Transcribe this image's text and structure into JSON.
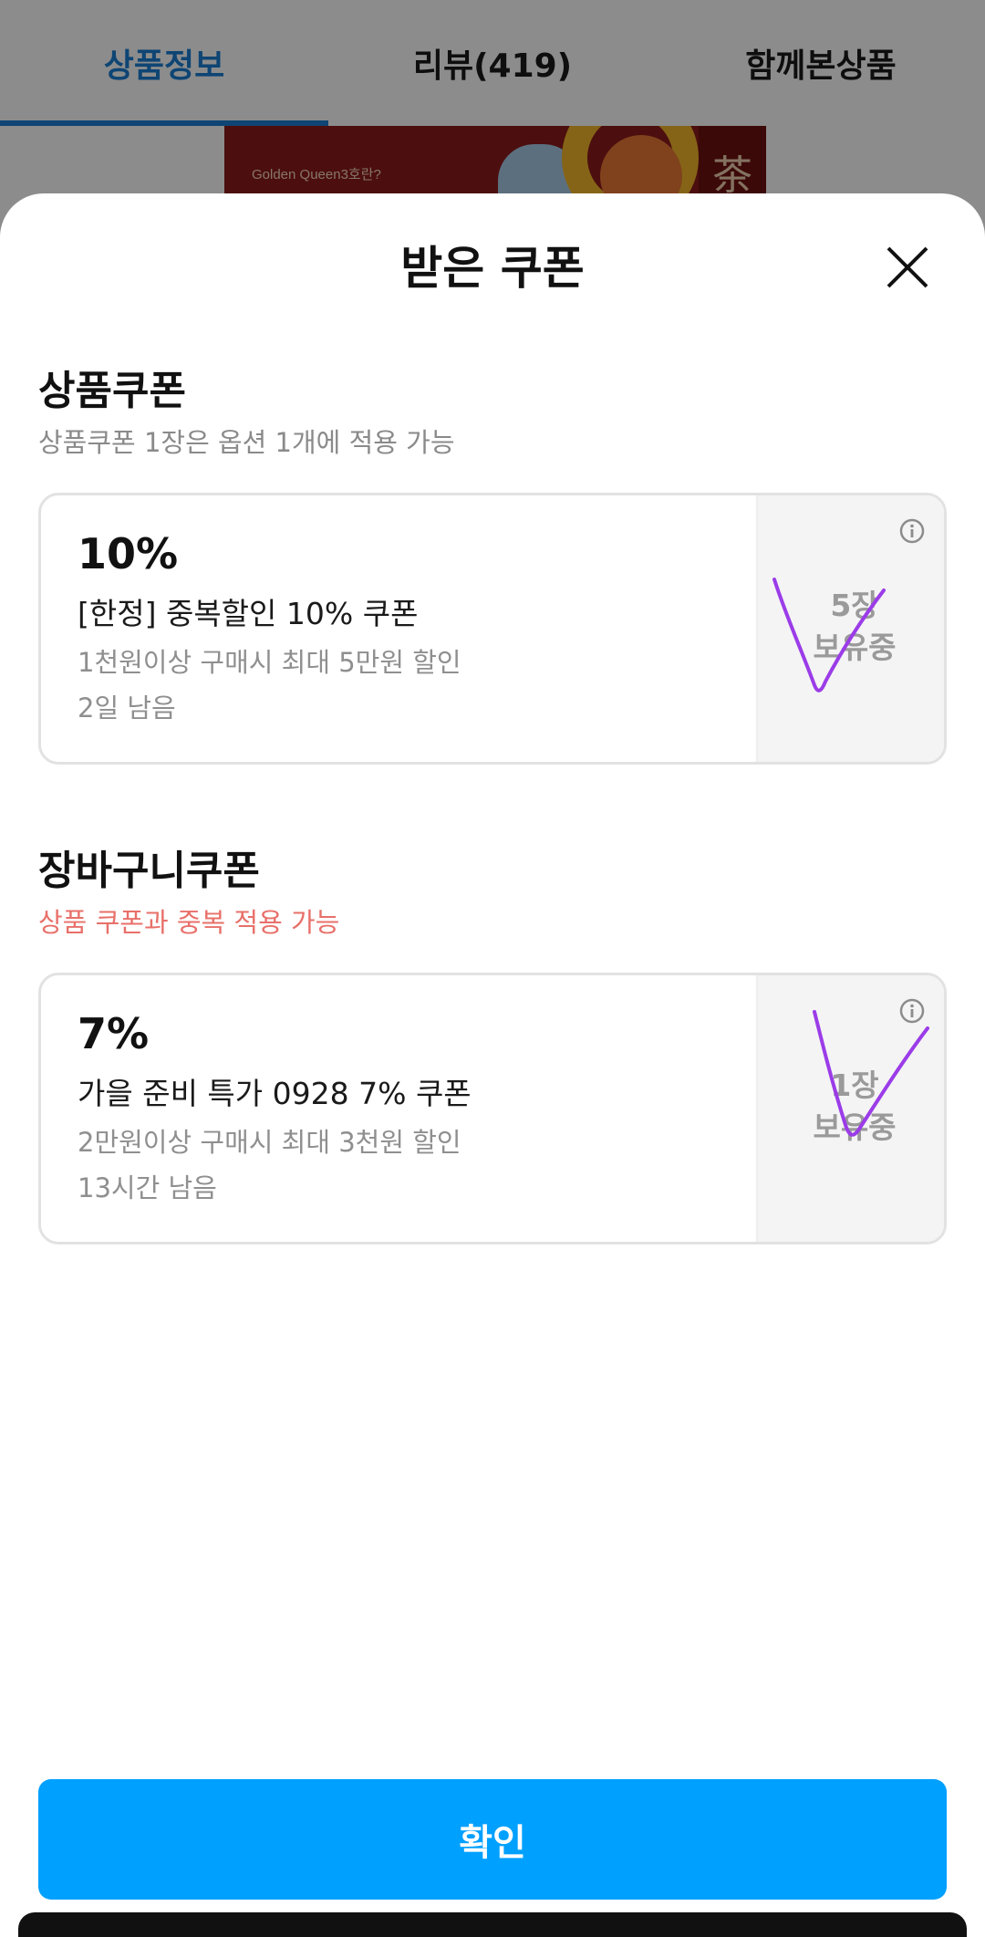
{
  "background": {
    "tabs": [
      {
        "label": "상품정보",
        "active": true
      },
      {
        "label": "리뷰(419)",
        "active": false
      },
      {
        "label": "함께본상품",
        "active": false
      }
    ],
    "product_image_text": "Golden Queen3호란?"
  },
  "sheet": {
    "title": "받은 쿠폰",
    "close_icon": "close-icon"
  },
  "product_coupons": {
    "title": "상품쿠폰",
    "subtitle": "상품쿠폰 1장은 옵션 1개에 적용 가능",
    "items": [
      {
        "discount": "10%",
        "name": "[한정] 중복할인 10% 쿠폰",
        "condition": "1천원이상 구매시 최대 5만원 할인",
        "remaining": "2일 남음",
        "count_line1": "5장",
        "count_line2": "보유중"
      }
    ]
  },
  "cart_coupons": {
    "title": "장바구니쿠폰",
    "subtitle": "상품 쿠폰과 중복 적용 가능",
    "items": [
      {
        "discount": "7%",
        "name": "가을 준비 특가 0928 7% 쿠폰",
        "condition": "2만원이상 구매시 최대 3천원 할인",
        "remaining": "13시간 남음",
        "count_line1": "1장",
        "count_line2": "보유중"
      }
    ]
  },
  "confirm_button": "확인",
  "colors": {
    "accent": "#00a0ff",
    "tab_active": "#1a7fd4",
    "subtitle_accent": "#e8706a",
    "annotation": "#9b3ce8"
  }
}
